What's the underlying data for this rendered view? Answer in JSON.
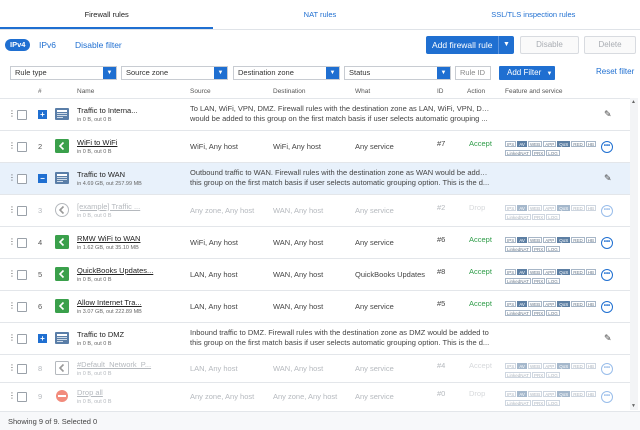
{
  "tabs": [
    {
      "label": "Firewall rules",
      "active": true
    },
    {
      "label": "NAT rules",
      "active": false
    },
    {
      "label": "SSL/TLS inspection rules",
      "active": false
    }
  ],
  "toolbar": {
    "ipv4": "IPv4",
    "ipv6": "IPv6",
    "disable_filter": "Disable filter",
    "add_rule": "Add firewall rule",
    "disable": "Disable",
    "delete": "Delete"
  },
  "filters": {
    "rule_type": "Rule type",
    "source_zone": "Source zone",
    "destination_zone": "Destination zone",
    "status": "Status",
    "rule_id_placeholder": "Rule ID",
    "add_filter": "Add Filter",
    "reset_filter": "Reset filter"
  },
  "columns": {
    "num": "#",
    "name": "Name",
    "source": "Source",
    "destination": "Destination",
    "what": "What",
    "id": "ID",
    "action": "Action",
    "feature": "Feature and service"
  },
  "rows": [
    {
      "type": "group",
      "name": "Traffic to Interna...",
      "stats": "in 0 B, out 0 B",
      "desc1": "To LAN, WiFi, VPN, DMZ. Firewall rules with the destination zone as LAN, WiFi, VPN, DMZ",
      "desc2": "would be added to this group on the first match basis if user selects automatic grouping ..."
    },
    {
      "type": "rule",
      "num": "2",
      "name": "WiFi to WiFi",
      "stats": "in 0 B, out 0 B",
      "source": "WiFi, Any host",
      "destination": "WiFi, Any host",
      "what": "Any service",
      "id": "#7",
      "action": "Accept"
    },
    {
      "type": "group",
      "selected": true,
      "name": "Traffic to WAN",
      "stats": "in 4.69 GB, out 257.99 MB",
      "desc1": "Outbound traffic to WAN. Firewall rules with the destination zone as WAN would be added to",
      "desc2": "this group on the first match basis if user selects automatic grouping option. This is the d..."
    },
    {
      "type": "rule",
      "off": true,
      "num": "3",
      "name": "[example] Traffic ...",
      "stats": "in 0 B, out 0 B",
      "source": "Any zone, Any host",
      "destination": "WAN, Any host",
      "what": "Any service",
      "id": "#2",
      "action": "Drop"
    },
    {
      "type": "rule",
      "num": "4",
      "name": "RMW WiFi to WAN",
      "stats": "in 1.62 GB, out 35.10 MB",
      "source": "WiFi, Any host",
      "destination": "WAN, Any host",
      "what": "Any service",
      "id": "#6",
      "action": "Accept"
    },
    {
      "type": "rule",
      "num": "5",
      "name": "QuickBooks Updates...",
      "stats": "in 0 B, out 0 B",
      "source": "LAN, Any host",
      "destination": "WAN, Any host",
      "what": "QuickBooks Updates",
      "id": "#8",
      "action": "Accept"
    },
    {
      "type": "rule",
      "num": "6",
      "name": "Allow Internet Tra...",
      "stats": "in 3.07 GB, out 222.89 MB",
      "source": "LAN, Any host",
      "destination": "WAN, Any host",
      "what": "Any service",
      "id": "#5",
      "action": "Accept"
    },
    {
      "type": "group",
      "name": "Traffic to DMZ",
      "stats": "in 0 B, out 0 B",
      "desc1": "Inbound traffic to DMZ. Firewall rules with the destination zone as DMZ would be added to",
      "desc2": "this group on the first match basis if user selects automatic grouping option. This is the d..."
    },
    {
      "type": "rule",
      "off": true,
      "num": "8",
      "name": "#Default_Network_P...",
      "stats": "in 0 B, out 0 B",
      "source": "LAN, Any host",
      "destination": "WAN, Any host",
      "what": "Any service",
      "id": "#4",
      "action": "Accept"
    },
    {
      "type": "rule",
      "off": true,
      "num": "9",
      "name": "Drop all",
      "stats": "in 0 B, out 0 B",
      "source": "Any zone, Any host",
      "destination": "Any zone, Any host",
      "what": "Any service",
      "id": "#0",
      "action": "Drop"
    }
  ],
  "feature_badges": {
    "line1": [
      "IPS",
      "AV",
      "WEB",
      "APP",
      "QoS",
      "RED",
      "HB"
    ],
    "line2": [
      "LinkedNAT",
      "PRX",
      "LOG"
    ]
  },
  "icons": {
    "group": "folder-group-icon",
    "accept": "arrow-accept-icon",
    "drop": "drop-icon"
  },
  "colors": {
    "accent": "#1f6fd1",
    "accept": "#2e9c48",
    "drop": "#d24c3f",
    "group_icon": "#5a7ea8"
  },
  "footer": {
    "status": "Showing 9 of 9. Selected 0"
  }
}
